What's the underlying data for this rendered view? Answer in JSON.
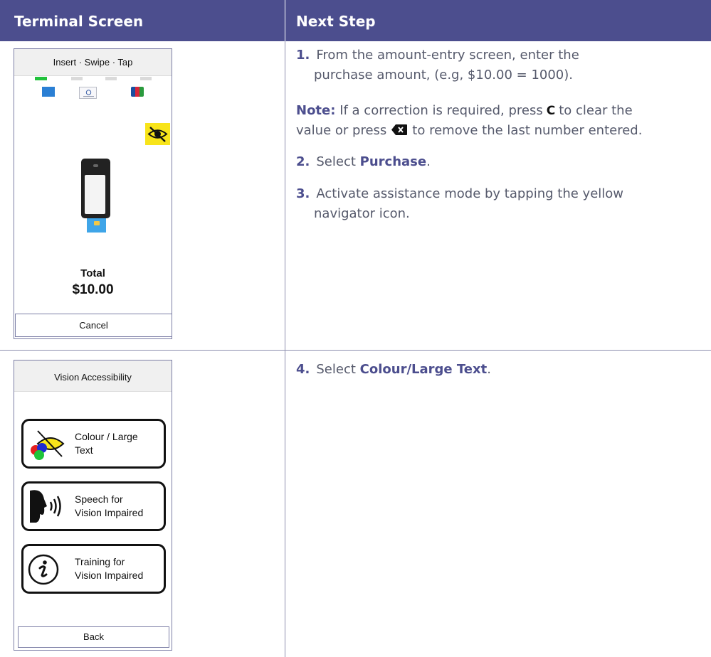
{
  "header": {
    "col_terminal": "Terminal Screen",
    "col_next": "Next Step"
  },
  "terminal1": {
    "title": "Insert · Swipe · Tap",
    "total_label": "Total",
    "total_amount": "$10.00",
    "cancel_label": "Cancel",
    "nav_icon": "eye-slash-icon",
    "nav_icon_color": "#f8e41a"
  },
  "terminal2": {
    "title": "Vision Accessibility",
    "items": [
      {
        "label_line1": "Colour / Large",
        "label_line2": "Text",
        "icon": "colour-eye-icon"
      },
      {
        "label_line1": "Speech for",
        "label_line2": "Vision Impaired",
        "icon": "speaking-head-icon"
      },
      {
        "label_line1": "Training for",
        "label_line2": "Vision Impaired",
        "icon": "info-circle-icon"
      }
    ],
    "back_label": "Back"
  },
  "steps": {
    "s1_num": "1.",
    "s1_text_a": "From the amount-entry screen, enter the",
    "s1_text_b": "purchase amount, (e.g, $10.00 = 1000).",
    "note_label": "Note:",
    "note_text_a": "If a correction is required, press",
    "note_key_c": "C",
    "note_text_b": "to clear the",
    "note_text_c": "value or press",
    "note_text_d": "to remove the last number entered.",
    "s2_num": "2.",
    "s2_text": "Select",
    "s2_strong": "Purchase",
    "s2_end": ".",
    "s3_num": "3.",
    "s3_text_a": "Activate assistance mode by tapping the yellow",
    "s3_text_b": "navigator icon.",
    "s4_num": "4.",
    "s4_text": "Select",
    "s4_strong": "Colour/Large Text",
    "s4_end": "."
  },
  "colors": {
    "header_bg": "#4c4e8e",
    "accent": "#4c4e8e",
    "body_text": "#55596b"
  }
}
